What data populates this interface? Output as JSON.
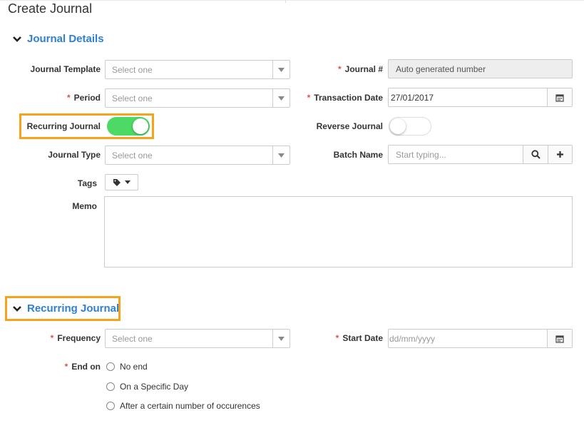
{
  "page": {
    "title": "Create Journal"
  },
  "colors": {
    "accent": "#2f80d1",
    "required": "#d9534f",
    "toggle_on": "#4cd964",
    "highlight": "#f6a21a"
  },
  "journal_details": {
    "heading": "Journal Details",
    "journal_template": {
      "label": "Journal Template",
      "placeholder": "Select one"
    },
    "journal_number": {
      "label": "Journal #",
      "value": "Auto generated number"
    },
    "period": {
      "label": "Period",
      "placeholder": "Select one"
    },
    "transaction_date": {
      "label": "Transaction Date",
      "value": "27/01/2017"
    },
    "recurring_journal": {
      "label": "Recurring Journal",
      "on": true
    },
    "reverse_journal": {
      "label": "Reverse Journal",
      "on": false
    },
    "journal_type": {
      "label": "Journal Type",
      "placeholder": "Select one"
    },
    "batch_name": {
      "label": "Batch Name",
      "placeholder": "Start typing..."
    },
    "tags": {
      "label": "Tags"
    },
    "memo": {
      "label": "Memo"
    }
  },
  "recurring_section": {
    "heading": "Recurring Journal",
    "frequency": {
      "label": "Frequency",
      "placeholder": "Select one"
    },
    "start_date": {
      "label": "Start Date",
      "placeholder": "dd/mm/yyyy"
    },
    "end_on": {
      "label": "End on",
      "options": [
        "No end",
        "On a Specific Day",
        "After a certain number of occurences"
      ]
    }
  },
  "required_mark": "*"
}
